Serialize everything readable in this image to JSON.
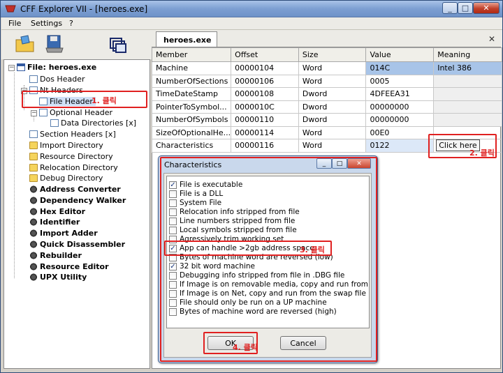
{
  "window": {
    "title": "CFF Explorer VII - [heroes.exe]",
    "minimize_glyph": "_",
    "maximize_glyph": "□",
    "close_glyph": "✕"
  },
  "menu": {
    "items": [
      "File",
      "Settings",
      "?"
    ]
  },
  "toolbar": {
    "icons": [
      "open-folder-icon",
      "save-disk-icon",
      "windows-icon"
    ]
  },
  "tree": {
    "root": "File: heroes.exe",
    "items": [
      {
        "label": "Dos Header",
        "bold": false
      },
      {
        "label": "Nt Headers",
        "bold": false
      },
      {
        "label": "File Header",
        "bold": false
      },
      {
        "label": "Optional Header",
        "bold": false
      },
      {
        "label": "Data Directories [x]",
        "bold": false
      },
      {
        "label": "Section Headers [x]",
        "bold": false
      },
      {
        "label": "Import Directory",
        "bold": false
      },
      {
        "label": "Resource Directory",
        "bold": false
      },
      {
        "label": "Relocation Directory",
        "bold": false
      },
      {
        "label": "Debug Directory",
        "bold": false
      },
      {
        "label": "Address Converter",
        "bold": true
      },
      {
        "label": "Dependency Walker",
        "bold": true
      },
      {
        "label": "Hex Editor",
        "bold": true
      },
      {
        "label": "Identifier",
        "bold": true
      },
      {
        "label": "Import Adder",
        "bold": true
      },
      {
        "label": "Quick Disassembler",
        "bold": true
      },
      {
        "label": "Rebuilder",
        "bold": true
      },
      {
        "label": "Resource Editor",
        "bold": true
      },
      {
        "label": "UPX Utility",
        "bold": true
      }
    ]
  },
  "tab": {
    "label": "heroes.exe",
    "close_glyph": "✕"
  },
  "grid": {
    "headers": [
      "Member",
      "Offset",
      "Size",
      "Value",
      "Meaning"
    ],
    "rows": [
      [
        "Machine",
        "00000104",
        "Word",
        "014C",
        "Intel 386"
      ],
      [
        "NumberOfSections",
        "00000106",
        "Word",
        "0005",
        ""
      ],
      [
        "TimeDateStamp",
        "00000108",
        "Dword",
        "4DFEEA31",
        ""
      ],
      [
        "PointerToSymbol...",
        "0000010C",
        "Dword",
        "00000000",
        ""
      ],
      [
        "NumberOfSymbols",
        "00000110",
        "Dword",
        "00000000",
        ""
      ],
      [
        "SizeOfOptionalHe...",
        "00000114",
        "Word",
        "00E0",
        ""
      ],
      [
        "Characteristics",
        "00000116",
        "Word",
        "0122",
        "Click here"
      ]
    ]
  },
  "annotations": {
    "step1": "1. 클릭",
    "step2": "2. 클릭",
    "step3": "3. 클릭",
    "step4": "4. 클릭"
  },
  "dialog": {
    "title": "Characteristics",
    "items": [
      {
        "label": "File is executable",
        "checked": true
      },
      {
        "label": "File is a DLL",
        "checked": false
      },
      {
        "label": "System File",
        "checked": false
      },
      {
        "label": "Relocation info stripped from file",
        "checked": false
      },
      {
        "label": "Line numbers stripped from file",
        "checked": false
      },
      {
        "label": "Local symbols stripped from file",
        "checked": false
      },
      {
        "label": "Agressively trim working set",
        "checked": false
      },
      {
        "label": "App can handle >2gb address space",
        "checked": true
      },
      {
        "label": "Bytes of machine word are reversed (low)",
        "checked": false
      },
      {
        "label": "32 bit word machine",
        "checked": true
      },
      {
        "label": "Debugging info stripped from file in .DBG file",
        "checked": false
      },
      {
        "label": "If Image is on removable media, copy and run from the swap",
        "checked": false
      },
      {
        "label": "If Image is on Net, copy and run from the swap file",
        "checked": false
      },
      {
        "label": "File should only be run on a UP machine",
        "checked": false
      },
      {
        "label": "Bytes of machine word are reversed (high)",
        "checked": false
      }
    ],
    "ok_label": "OK",
    "cancel_label": "Cancel",
    "check_glyph": "✓"
  },
  "colors": {
    "annotation_red": "#e02020",
    "selection_blue": "#a8c4e8"
  }
}
